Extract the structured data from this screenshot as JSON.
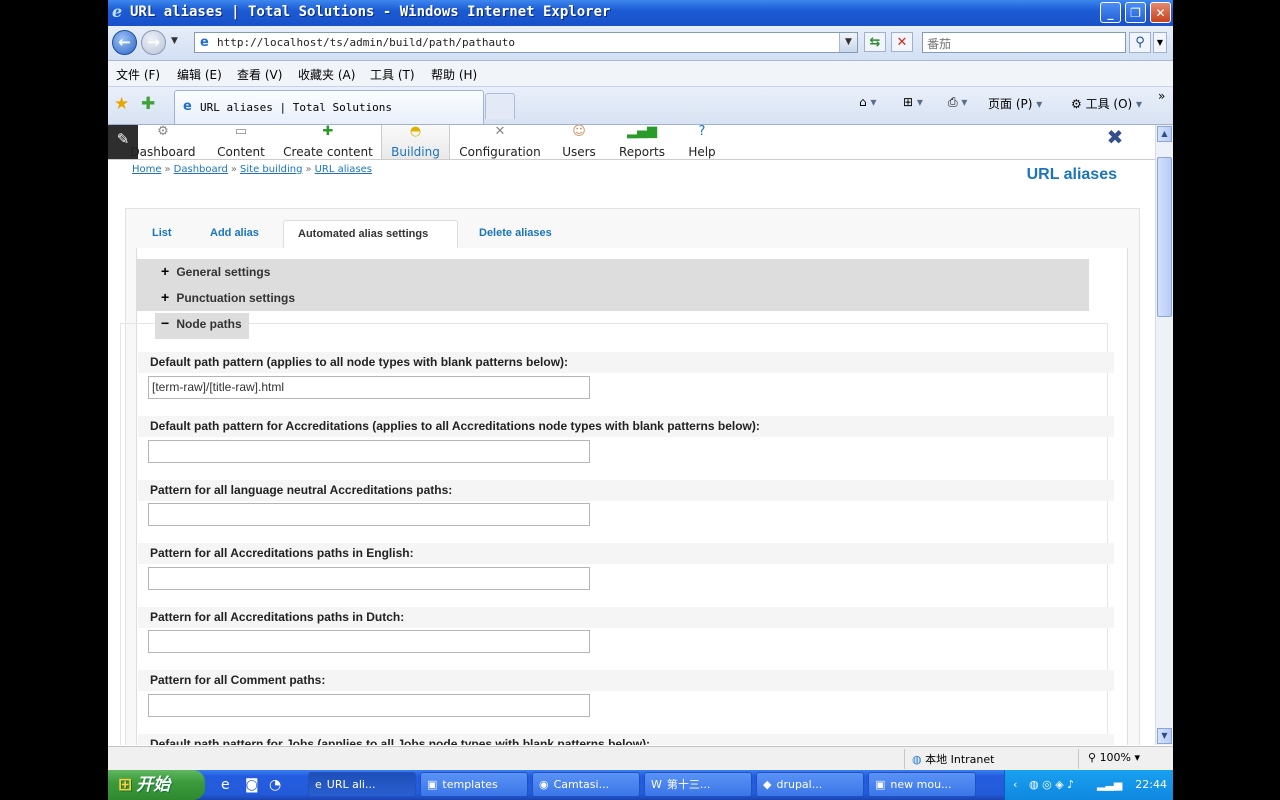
{
  "window": {
    "title": "URL aliases | Total Solutions - Windows Internet Explorer"
  },
  "address": {
    "url": "http://localhost/ts/admin/build/path/pathauto",
    "search_placeholder": "番茄"
  },
  "ie_menu": {
    "items": [
      "文件 (F)",
      "编辑 (E)",
      "查看 (V)",
      "收藏夹 (A)",
      "工具 (T)",
      "帮助 (H)"
    ]
  },
  "tab": {
    "label": "URL aliases | Total Solutions"
  },
  "commands": {
    "page": "页面 (P)",
    "tools": "工具 (O)"
  },
  "admin_menu": {
    "items": [
      {
        "label": "Dashboard",
        "icon": "gauge-icon"
      },
      {
        "label": "Content",
        "icon": "document-icon"
      },
      {
        "label": "Create content",
        "icon": "add-icon"
      },
      {
        "label": "Building",
        "icon": "hardhat-icon"
      },
      {
        "label": "Configuration",
        "icon": "tools-icon"
      },
      {
        "label": "Users",
        "icon": "user-icon"
      },
      {
        "label": "Reports",
        "icon": "bar-chart-icon"
      },
      {
        "label": "Help",
        "icon": "help-icon"
      }
    ],
    "active": "Building"
  },
  "breadcrumb": [
    "Home",
    "Dashboard",
    "Site building",
    "URL aliases"
  ],
  "breadcrumb_separator": "»",
  "page_title": "URL aliases",
  "tabs": [
    "List",
    "Add alias",
    "Automated alias settings",
    "Delete aliases"
  ],
  "active_tab": "Automated alias settings",
  "fieldsets": {
    "general": {
      "label": "General settings",
      "sign": "+"
    },
    "punctuation": {
      "label": "Punctuation settings",
      "sign": "+"
    },
    "node_paths": {
      "label": "Node paths",
      "sign": "−"
    }
  },
  "fields": [
    {
      "label": "Default path pattern (applies to all node types with blank patterns below):",
      "value": "[term-raw]/[title-raw].html"
    },
    {
      "label": "Default path pattern for Accreditations (applies to all Accreditations node types with blank patterns below):",
      "value": ""
    },
    {
      "label": "Pattern for all language neutral Accreditations paths:",
      "value": ""
    },
    {
      "label": "Pattern for all Accreditations paths in English:",
      "value": ""
    },
    {
      "label": "Pattern for all Accreditations paths in Dutch:",
      "value": ""
    },
    {
      "label": "Pattern for all Comment paths:",
      "value": ""
    },
    {
      "label": "Default path pattern for Jobs (applies to all Jobs node types with blank patterns below):",
      "value": ""
    }
  ],
  "status": {
    "zone": "本地 Intranet",
    "zoom": "100%"
  },
  "taskbar": {
    "start": "开始",
    "tasks": [
      "URL ali...",
      "templates",
      "Camtasi...",
      "第十三...",
      "drupal...",
      "new mou..."
    ],
    "clock": "22:44"
  },
  "colors": {
    "drupal_link": "#1b75bb",
    "xp_blue": "#245ce0",
    "start_green": "#3c9a3c"
  }
}
